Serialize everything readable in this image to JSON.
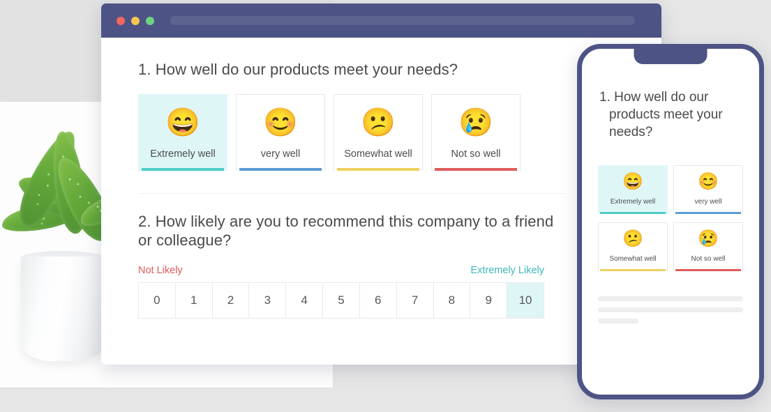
{
  "background": {
    "grey_panel": "#e2e2e2",
    "white_panel": "#fdfdfd",
    "photo_alt": "potted aloe plant in white ceramic pot"
  },
  "browser": {
    "chrome_color": "#4d5485",
    "url_bar_value": "",
    "traffic_lights": [
      {
        "name": "close",
        "color": "#f2675f"
      },
      {
        "name": "minimize",
        "color": "#f6c651"
      },
      {
        "name": "maximize",
        "color": "#6fd283"
      }
    ]
  },
  "survey": {
    "question1": {
      "text": "1. How well do our products meet your needs?",
      "options": [
        {
          "emoji": "😄",
          "emoji_name": "grinning-face-with-smiling-eyes",
          "label": "Extremely well",
          "accent": "#4ecdc8",
          "selected": true
        },
        {
          "emoji": "😊",
          "emoji_name": "smiling-face-with-smiling-eyes",
          "label": "very well",
          "accent": "#5b9bd5",
          "selected": false
        },
        {
          "emoji": "😕",
          "emoji_name": "confused-face",
          "label": "Somewhat well",
          "accent": "#f0d060",
          "selected": false
        },
        {
          "emoji": "😢",
          "emoji_name": "crying-face",
          "label": "Not so well",
          "accent": "#e05a5a",
          "selected": false
        }
      ]
    },
    "question2": {
      "text": "2. How likely are you to recommend this company to a friend or colleague?",
      "low_label": "Not Likely",
      "low_color": "#e05a5a",
      "high_label": "Extremely Likely",
      "high_color": "#3fb6b9",
      "scale": [
        "0",
        "1",
        "2",
        "3",
        "4",
        "5",
        "6",
        "7",
        "8",
        "9",
        "10"
      ],
      "selected_value": "10"
    }
  },
  "phone": {
    "bezel_color": "#4d5485",
    "question": "1. How well do our products meet your needs?",
    "options": [
      {
        "emoji": "😄",
        "emoji_name": "grinning-face-with-smiling-eyes",
        "label": "Extremely well",
        "accent": "#4ecdc8",
        "selected": true
      },
      {
        "emoji": "😊",
        "emoji_name": "smiling-face-with-smiling-eyes",
        "label": "very well",
        "accent": "#5b9bd5",
        "selected": false
      },
      {
        "emoji": "😕",
        "emoji_name": "confused-face",
        "label": "Somewhat well",
        "accent": "#f0d060",
        "selected": false
      },
      {
        "emoji": "😢",
        "emoji_name": "crying-face",
        "label": "Not so well",
        "accent": "#e05a5a",
        "selected": false
      }
    ],
    "placeholder_bars": 3
  }
}
